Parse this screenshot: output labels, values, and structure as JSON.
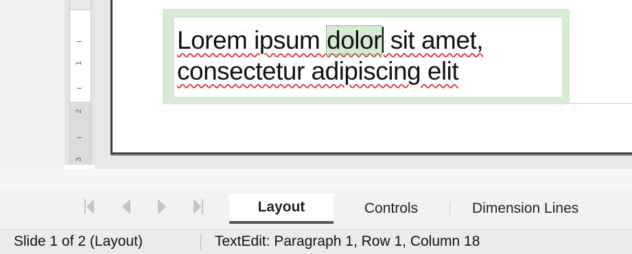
{
  "ruler": {
    "numbers": [
      "1",
      "2",
      "3"
    ]
  },
  "slide": {
    "text_line1": {
      "before": "Lorem ipsum ",
      "selected": "dolor",
      "after": " sit amet,"
    },
    "text_line2": "consectetur adipiscing elit"
  },
  "tabs": {
    "nav_icons": [
      "first-page-icon",
      "previous-page-icon",
      "next-page-icon",
      "last-page-icon"
    ],
    "items": [
      {
        "label": "Layout",
        "active": true
      },
      {
        "label": "Controls",
        "active": false
      },
      {
        "label": "Dimension Lines",
        "active": false
      }
    ]
  },
  "statusbar": {
    "slide_info": "Slide 1 of 2 (Layout)",
    "edit_info": "TextEdit: Paragraph 1, Row 1, Column 18"
  },
  "colors": {
    "selection_frame": "#d7ead4",
    "spellcheck_underline": "#e04040",
    "active_tab_underline": "#555555"
  }
}
